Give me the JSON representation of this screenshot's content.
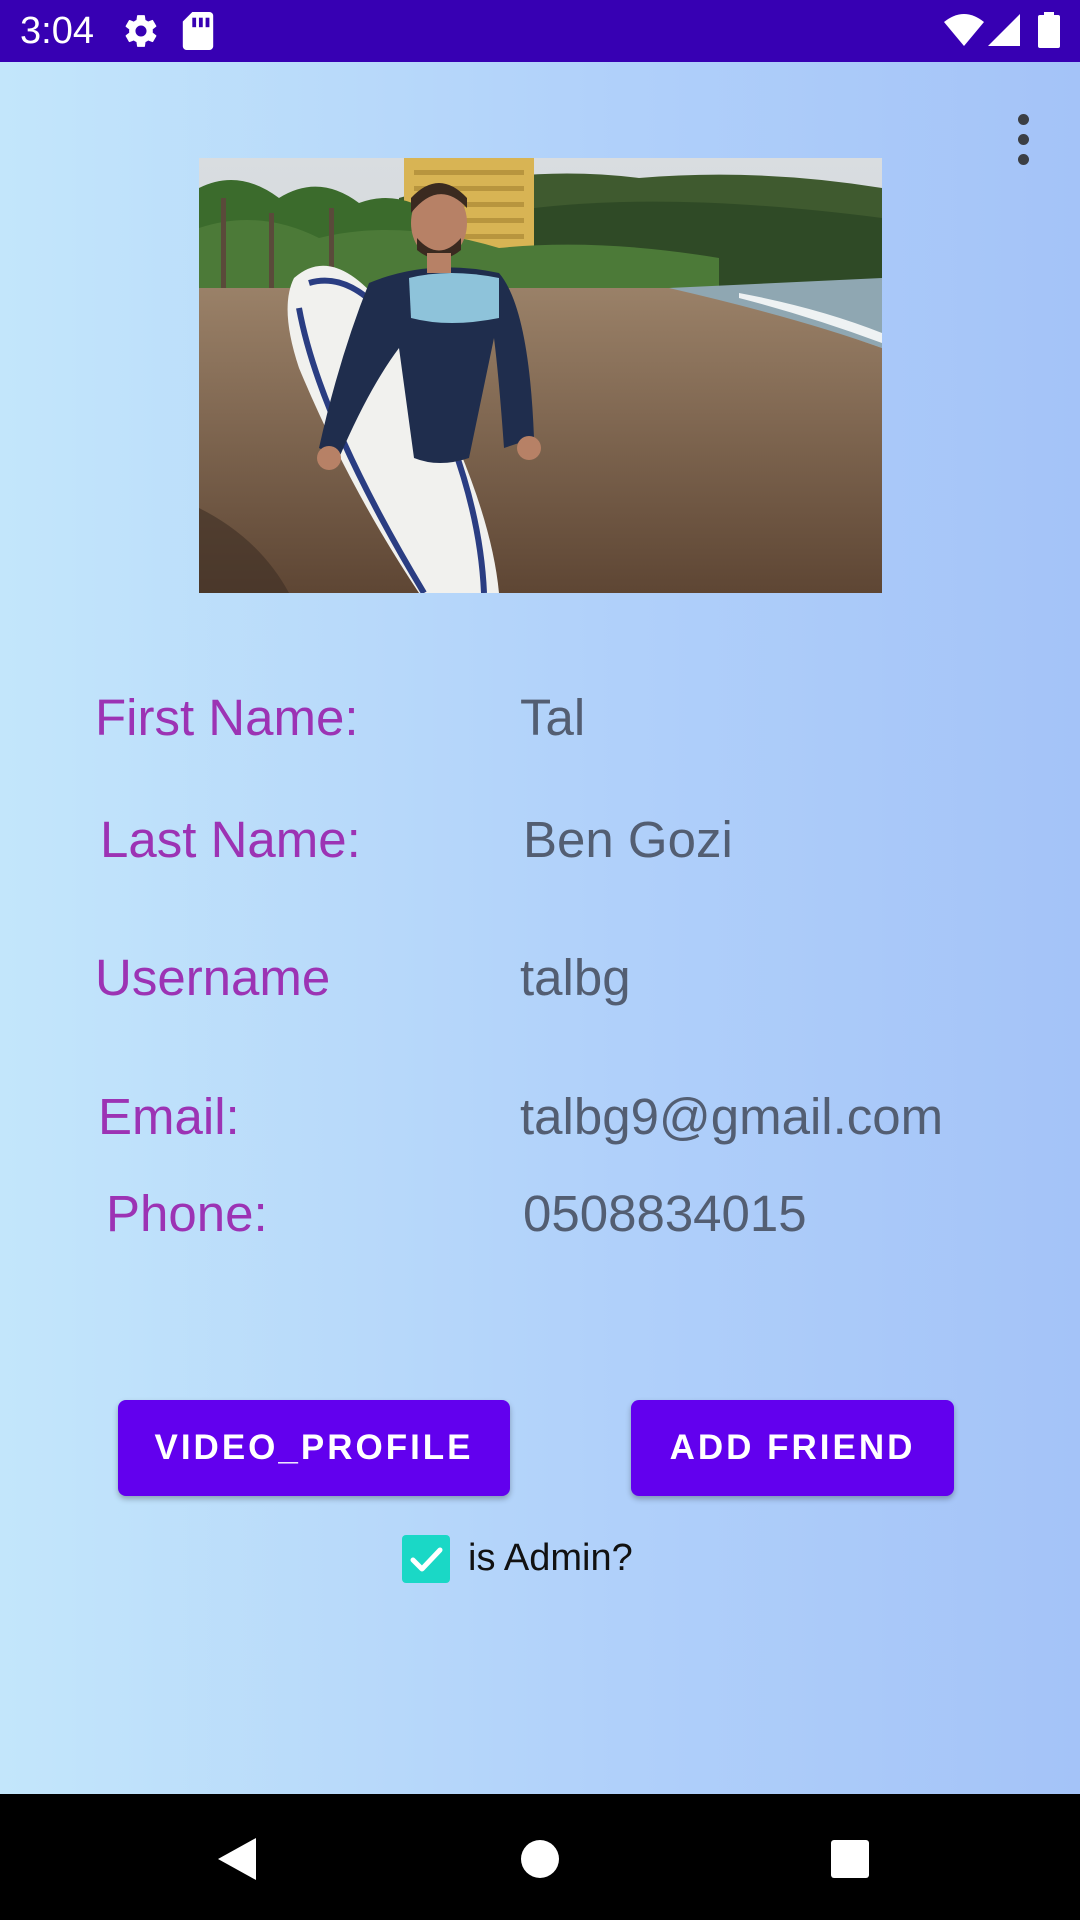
{
  "status_bar": {
    "time": "3:04",
    "left_icons": [
      "settings-gear-icon",
      "sd-card-icon"
    ],
    "right_icons": [
      "wifi-icon",
      "cell-signal-icon",
      "battery-icon"
    ],
    "background": "#3700b3"
  },
  "app_bar": {
    "menu_icon": "more-vert-icon"
  },
  "profile": {
    "photo": "profile-photo-man-with-surfboard-on-beach",
    "fields": [
      {
        "label": "First Name:",
        "value": "Tal"
      },
      {
        "label": "Last Name:",
        "value": "Ben Gozi"
      },
      {
        "label": "Username",
        "value": "talbg"
      },
      {
        "label": "Email:",
        "value": "talbg9@gmail.com"
      },
      {
        "label": "Phone:",
        "value": "0508834015"
      }
    ]
  },
  "actions": {
    "video_profile_label": "VIDEO_PROFILE",
    "add_friend_label": "ADD FRIEND"
  },
  "admin": {
    "label": "is Admin?",
    "checked": true
  },
  "nav_bar": {
    "icons": [
      "back-icon",
      "home-icon",
      "recents-icon"
    ]
  },
  "colors": {
    "label": "#9c33b4",
    "value": "#535e72",
    "button": "#6200ee",
    "checkbox": "#1ad8c6"
  }
}
